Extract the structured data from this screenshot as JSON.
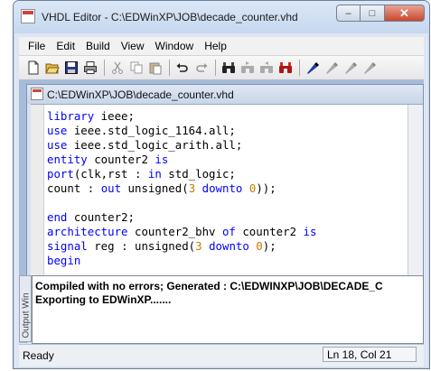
{
  "window": {
    "title": "VHDL Editor - C:\\EDWinXP\\JOB\\decade_counter.vhd",
    "minimize": "–",
    "maximize": "□",
    "close": "✕"
  },
  "menu": [
    "File",
    "Edit",
    "Build",
    "View",
    "Window",
    "Help"
  ],
  "toolbar": {
    "icons": [
      "new-file-icon",
      "open-folder-icon",
      "save-icon",
      "print-icon",
      "cut-icon",
      "copy-icon",
      "paste-icon",
      "undo-icon",
      "redo-icon",
      "find-icon",
      "find-next-icon",
      "find-previous-icon",
      "replace-icon",
      "toggle-bookmark-icon",
      "next-bookmark-icon",
      "previous-bookmark-icon",
      "clear-bookmarks-icon"
    ]
  },
  "editor": {
    "title": "C:\\EDWinXP\\JOB\\decade_counter.vhd",
    "keyword_color": "#0000ff",
    "number_color": "#c47b00"
  },
  "output": {
    "label": "Output Win",
    "lines": [
      "Compiled with no errors; Generated : C:\\EDWINXP\\JOB\\DECADE_C",
      "Exporting to EDWinXP......."
    ]
  },
  "status": {
    "left": "Ready",
    "right": "Ln 18, Col 21"
  }
}
